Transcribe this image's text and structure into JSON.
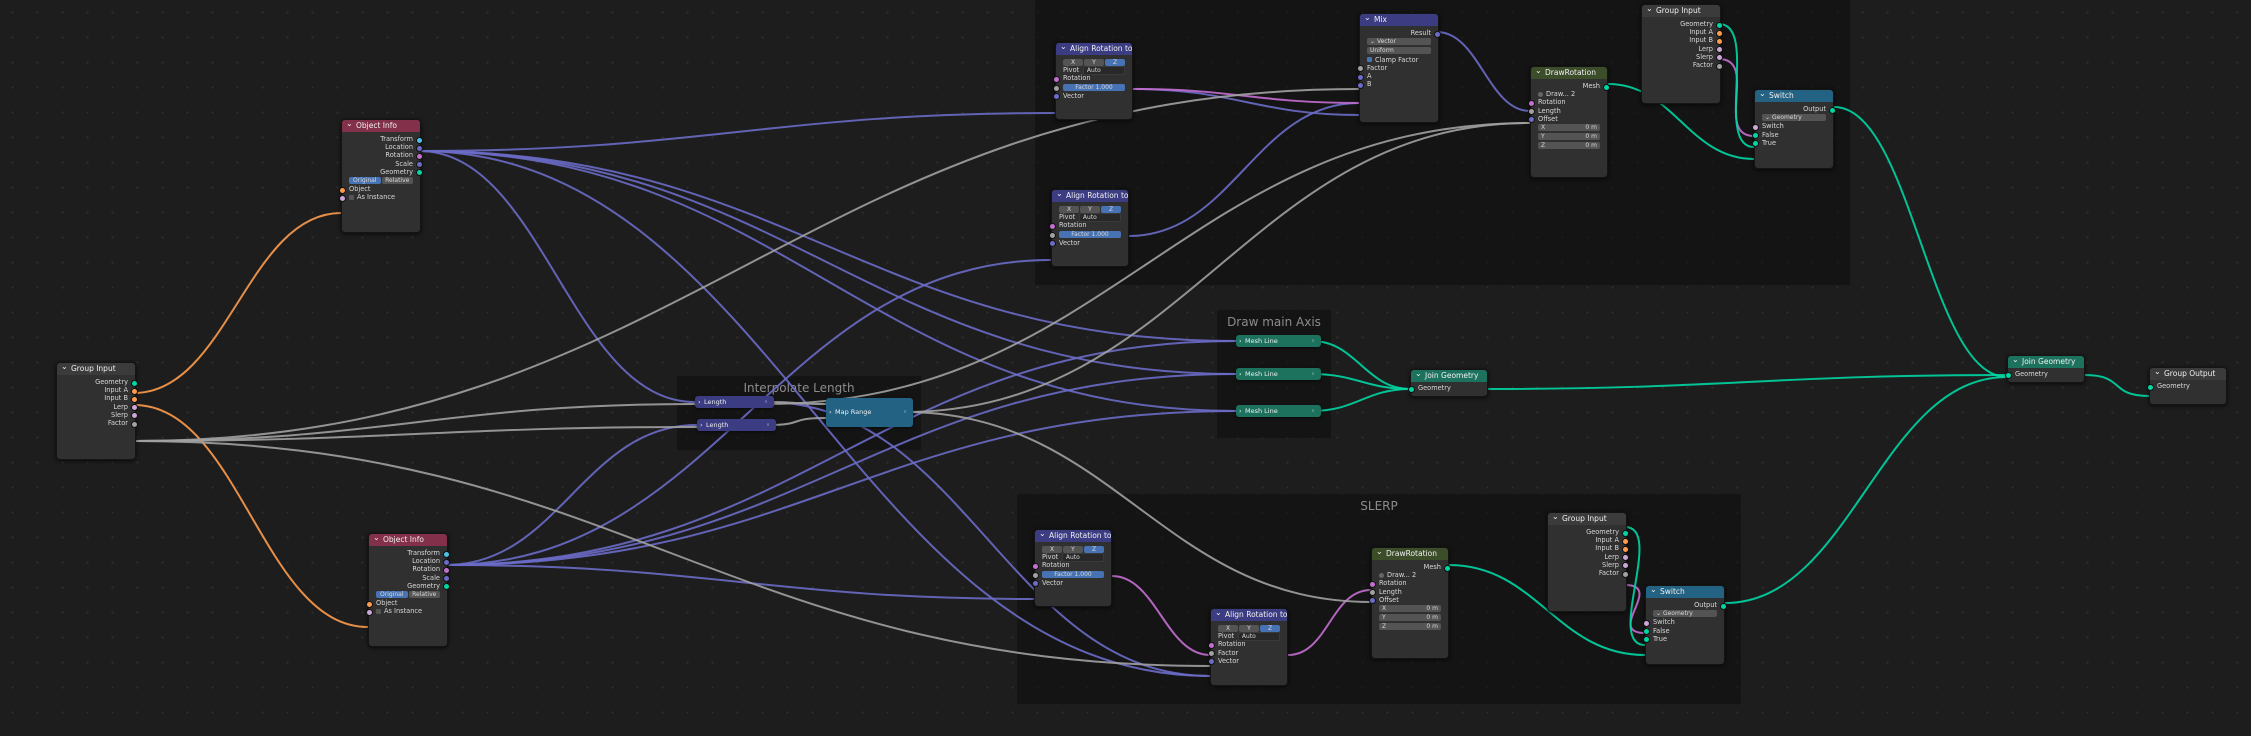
{
  "colors": {
    "vector": "#6c6cc8",
    "float": "#a1a1a1",
    "rotation": "#c46ed1",
    "geometry": "#00d6a3",
    "object": "#ff9c4c",
    "header_object": "#83314a",
    "header_vector": "#3c3c83",
    "header_converter": "#246283",
    "header_geometry": "#1d725e"
  },
  "frames": {
    "top": "",
    "axis": "Draw main Axis",
    "interp": "Interpolate Length",
    "slerp": "SLERP"
  },
  "object_info_top": {
    "title": "Object Info",
    "outputs": [
      "Transform",
      "Location",
      "Rotation",
      "Scale",
      "Geometry"
    ],
    "mode_original": "Original",
    "mode_relative": "Relative",
    "input_object": "Object",
    "input_instance": "As Instance"
  },
  "object_info_bottom": {
    "title": "Object Info",
    "outputs": [
      "Transform",
      "Location",
      "Rotation",
      "Scale",
      "Geometry"
    ],
    "mode_original": "Original",
    "mode_relative": "Relative",
    "input_object": "Object",
    "input_instance": "As Instance"
  },
  "group_input_main": {
    "title": "Group Input",
    "outputs": [
      "Geometry",
      "Input A",
      "Input B",
      "Lerp",
      "Slerp",
      "Factor"
    ]
  },
  "group_input_top": {
    "title": "Group Input",
    "outputs": [
      "Geometry",
      "Input A",
      "Input B",
      "Lerp",
      "Slerp",
      "Factor"
    ]
  },
  "group_input_bottom": {
    "title": "Group Input",
    "outputs": [
      "Geometry",
      "Input A",
      "Input B",
      "Lerp",
      "Slerp",
      "Factor"
    ]
  },
  "align_top_1": {
    "title": "Align Rotation to ...",
    "axes": [
      "X",
      "Y",
      "Z"
    ],
    "pivot_label": "Pivot",
    "pivot_value": "Auto",
    "input_rotation": "Rotation",
    "factor_label": "Factor",
    "factor_value": "1.000",
    "input_vector": "Vector"
  },
  "align_top_2": {
    "title": "Align Rotation to ...",
    "axes": [
      "X",
      "Y",
      "Z"
    ],
    "pivot_label": "Pivot",
    "pivot_value": "Auto",
    "input_rotation": "Rotation",
    "factor_label": "Factor",
    "factor_value": "1.000",
    "input_vector": "Vector"
  },
  "align_bottom_1": {
    "title": "Align Rotation to ...",
    "axes": [
      "X",
      "Y",
      "Z"
    ],
    "pivot_label": "Pivot",
    "pivot_value": "Auto",
    "input_rotation": "Rotation",
    "factor_label": "Factor",
    "factor_value": "1.000",
    "input_vector": "Vector"
  },
  "align_bottom_2": {
    "title": "Align Rotation to ...",
    "axes": [
      "X",
      "Y",
      "Z"
    ],
    "pivot_label": "Pivot",
    "pivot_value": "Auto",
    "input_rotation": "Rotation",
    "input_factor": "Factor",
    "input_vector": "Vector"
  },
  "mix": {
    "title": "Mix",
    "output_result": "Result",
    "type_value": "Vector",
    "mode_value": "Uniform",
    "clamp_label": "Clamp Factor",
    "input_factor": "Factor",
    "input_a": "A",
    "input_b": "B"
  },
  "draw_rotation_top": {
    "title": "DrawRotation",
    "output_mesh": "Mesh",
    "datablock": "Draw...",
    "users": "2",
    "input_rotation": "Rotation",
    "input_length": "Length",
    "input_offset": "Offset",
    "x_label": "X",
    "x_value": "0 m",
    "y_label": "Y",
    "y_value": "0 m",
    "z_label": "Z",
    "z_value": "0 m"
  },
  "draw_rotation_bottom": {
    "title": "DrawRotation",
    "output_mesh": "Mesh",
    "datablock": "Draw...",
    "users": "2",
    "input_rotation": "Rotation",
    "input_length": "Length",
    "input_offset": "Offset",
    "x_label": "X",
    "x_value": "0 m",
    "y_label": "Y",
    "y_value": "0 m",
    "z_label": "Z",
    "z_value": "0 m"
  },
  "switch_top": {
    "title": "Switch",
    "output": "Output",
    "type_value": "Geometry",
    "input_switch": "Switch",
    "input_false": "False",
    "input_true": "True"
  },
  "switch_bottom": {
    "title": "Switch",
    "output": "Output",
    "type_value": "Geometry",
    "input_switch": "Switch",
    "input_false": "False",
    "input_true": "True"
  },
  "length_1": {
    "label": "Length"
  },
  "length_2": {
    "label": "Length"
  },
  "map_range": {
    "label": "Map Range"
  },
  "mesh_line_1": {
    "label": "Mesh Line"
  },
  "mesh_line_2": {
    "label": "Mesh Line"
  },
  "mesh_line_3": {
    "label": "Mesh Line"
  },
  "join_geometry_mid": {
    "title": "Join Geometry",
    "input": "Geometry"
  },
  "join_geometry_right": {
    "title": "Join Geometry",
    "input": "Geometry"
  },
  "group_output": {
    "title": "Group Output",
    "input": "Geometry"
  }
}
